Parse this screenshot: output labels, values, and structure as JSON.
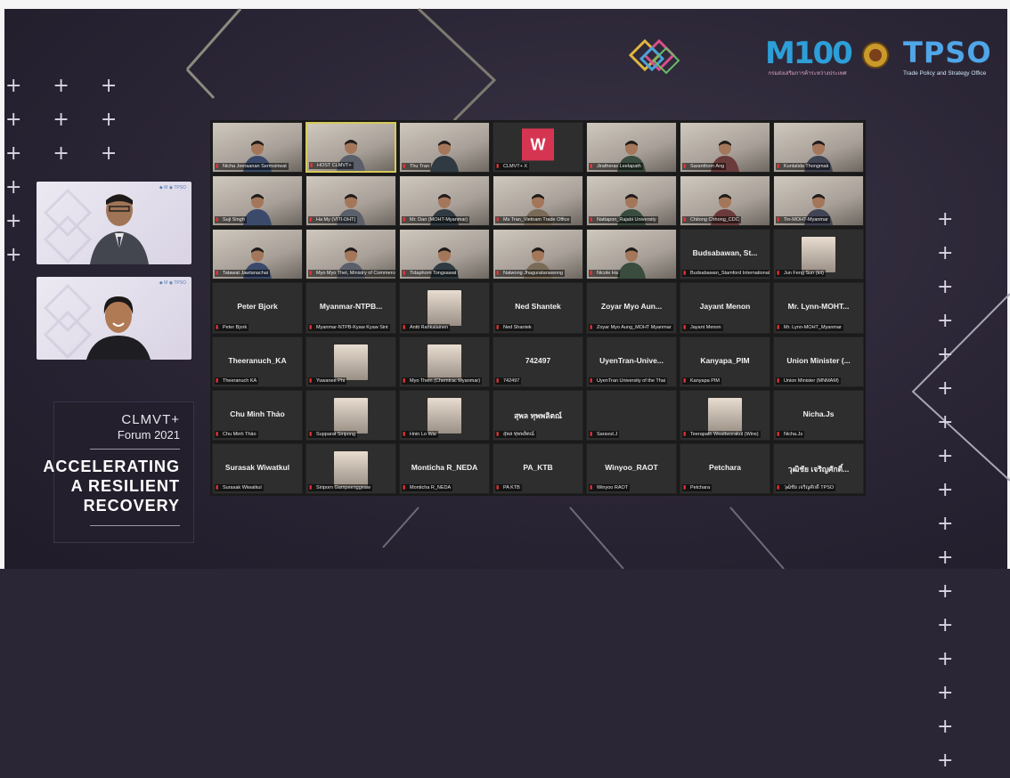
{
  "forum": {
    "title_line1": "CLMVT+",
    "title_line2": "Forum 2021",
    "headline": [
      "ACCELERATING",
      "A RESILIENT",
      "RECOVERY"
    ]
  },
  "logos": {
    "m100_text": "M100",
    "m100_sub": "กรมส่งเสริมการค้าระหว่างประเทศ",
    "tpso_text": "TPSO",
    "tpso_sub": "Trade Policy and Strategy Office"
  },
  "colors": {
    "background": "#2a2535",
    "grid_background": "#1a1a1a",
    "tile_background": "#2e2e2e",
    "active_speaker_border": "#d8c95a",
    "muted_mic": "#e13b3b",
    "tpso_blue": "#4fa6e8"
  },
  "gallery": {
    "tiles": [
      {
        "type": "video",
        "name": "",
        "label": "Nicha Jeeraanan Sermsiriwat"
      },
      {
        "type": "video",
        "name": "",
        "label": "HOST CLMVT+",
        "active": true
      },
      {
        "type": "video",
        "name": "",
        "label": "Thu Tran"
      },
      {
        "type": "logo",
        "name": "W",
        "label": "CLMVT+ X"
      },
      {
        "type": "video",
        "name": "",
        "label": "Jiratheras Leelapath"
      },
      {
        "type": "video",
        "name": "",
        "label": "Saranthorn Ang"
      },
      {
        "type": "video",
        "name": "",
        "label": "Kunlatida Thongmak"
      },
      {
        "type": "video",
        "name": "",
        "label": "Suji Singh"
      },
      {
        "type": "video",
        "name": "",
        "label": "Ha My (VITI-DHT)"
      },
      {
        "type": "video",
        "name": "",
        "label": "Mr. Dan (MOHT-Myanmar)"
      },
      {
        "type": "video",
        "name": "",
        "label": "Ms Tran_Vietnam Trade Office"
      },
      {
        "type": "video",
        "name": "",
        "label": "Nattapon_Rajabi University"
      },
      {
        "type": "video",
        "name": "",
        "label": "Chitong Chhong_CDC"
      },
      {
        "type": "video",
        "name": "",
        "label": "Tin-MOHT-Myanmar"
      },
      {
        "type": "video",
        "name": "",
        "label": "Tatawat Jawtanachai"
      },
      {
        "type": "video",
        "name": "",
        "label": "Myo Myo Thet, Ministry of Commerce"
      },
      {
        "type": "video",
        "name": "",
        "label": "Tidaphorn Tongsawat"
      },
      {
        "type": "video",
        "name": "",
        "label": "Natwong Jhaguratanawong"
      },
      {
        "type": "video",
        "name": "",
        "label": "Nicole Ha"
      },
      {
        "type": "text",
        "name": "Budsabawan, St...",
        "label": "Budsabawan_Stamford International"
      },
      {
        "type": "thumb",
        "name": "",
        "label": "Jun Feng Sun (kit)"
      },
      {
        "type": "text",
        "name": "Peter Bjork",
        "label": "Peter Bjork"
      },
      {
        "type": "text",
        "name": "Myanmar-NTPB...",
        "label": "Myanmar-NTPB-Kyaw Kyaw Sint"
      },
      {
        "type": "thumb",
        "name": "",
        "label": "Antti Rahkalainen"
      },
      {
        "type": "text",
        "name": "Ned Shantek",
        "label": "Ned Shantek"
      },
      {
        "type": "text",
        "name": "Zoyar Myo Aun...",
        "label": "Zoyar Myo Aung_MOHT Myanmar"
      },
      {
        "type": "text",
        "name": "Jayant Menon",
        "label": "Jayant Menon"
      },
      {
        "type": "text",
        "name": "Mr. Lynn-MOHT...",
        "label": "Mr. Lynn-MOHT_Myanmar"
      },
      {
        "type": "text",
        "name": "Theeranuch_KA",
        "label": "Theeranuch KA"
      },
      {
        "type": "thumb",
        "name": "",
        "label": "Yuwanee Phi"
      },
      {
        "type": "thumb",
        "name": "",
        "label": "Myo Thein (Chemtrac Myanmar)"
      },
      {
        "type": "text",
        "name": "742497",
        "label": "742497"
      },
      {
        "type": "text",
        "name": "UyenTran-Unive...",
        "label": "UyenTran University of the Thai"
      },
      {
        "type": "text",
        "name": "Kanyapa_PIM",
        "label": "Kanyapa PIM"
      },
      {
        "type": "text",
        "name": "Union Minister (...",
        "label": "Union Minister (MNMAM)"
      },
      {
        "type": "text",
        "name": "Chu Minh Thảo",
        "label": "Chu Minh Thảo"
      },
      {
        "type": "thumb",
        "name": "",
        "label": "Supparat Siripong"
      },
      {
        "type": "thumb",
        "name": "",
        "label": "Hnin Lo Wai"
      },
      {
        "type": "text",
        "name": "สุพล ทุพพลิตณ์",
        "label": "สุพล ทุพพลิตณ์"
      },
      {
        "type": "text",
        "name": "",
        "label": "Saravut.J"
      },
      {
        "type": "thumb",
        "name": "",
        "label": "Teerapath Weattworakul (Wins)"
      },
      {
        "type": "text",
        "name": "Nicha.Js",
        "label": "Nicha.Js"
      },
      {
        "type": "text",
        "name": "Surasak Wiwatkul",
        "label": "Surasak Wiwatkul"
      },
      {
        "type": "thumb",
        "name": "",
        "label": "Siriporn Gampeenggeaw"
      },
      {
        "type": "text",
        "name": "Monticha R_NEDA",
        "label": "Monticha R_NEDA"
      },
      {
        "type": "text",
        "name": "PA_KTB",
        "label": "PA KTB"
      },
      {
        "type": "text",
        "name": "Winyoo_RAOT",
        "label": "Winyoo RAOT"
      },
      {
        "type": "text",
        "name": "Petchara",
        "label": "Petchara"
      },
      {
        "type": "text",
        "name": "วุฒิชัย เจริญศักดิ์...",
        "label": "วุฒิชัย เจริญศักดิ์ TPSO"
      }
    ]
  }
}
